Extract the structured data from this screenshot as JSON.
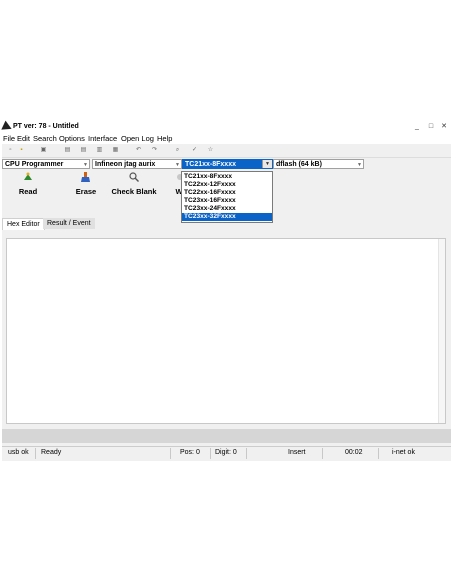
{
  "window": {
    "title": "PT ver: 78 - Untitled",
    "controls": [
      "_",
      "□",
      "✕"
    ]
  },
  "menu": [
    "File",
    "Edit",
    "Search",
    "Options",
    "Interface",
    "Open Log",
    "Help"
  ],
  "toolbar_icons": [
    "new-icon",
    "open-icon",
    "save-icon",
    "cut-icon",
    "copy-icon",
    "paste-icon",
    "print-icon",
    "undo-icon",
    "redo-icon",
    "find-icon",
    "check-icon",
    "star-icon"
  ],
  "selectors": {
    "programmer": "CPU Programmer",
    "interface": "Infineon jtag aurix",
    "chip": "TC21xx-8Fxxxx",
    "memory": "dflash (64 kB)"
  },
  "chip_options": [
    "TC21xx-8Fxxxx",
    "TC22xx-12Fxxxx",
    "TC22xx-16Fxxxx",
    "TC23xx-16Fxxxx",
    "TC23xx-24Fxxxx",
    "TC23xx-32Fxxxx"
  ],
  "chip_highlighted": "TC23xx-32Fxxxx",
  "actions": {
    "read": "Read",
    "erase": "Erase",
    "check_blank": "Check Blank",
    "write_partial": "W"
  },
  "tabs": [
    "Hex Editor",
    "Result / Event"
  ],
  "status": {
    "usb": "usb ok",
    "state": "Ready",
    "pos": "Pos: 0",
    "digit": "Digit: 0",
    "mode": "Insert",
    "time": "00:02",
    "net": "i-net ok"
  }
}
